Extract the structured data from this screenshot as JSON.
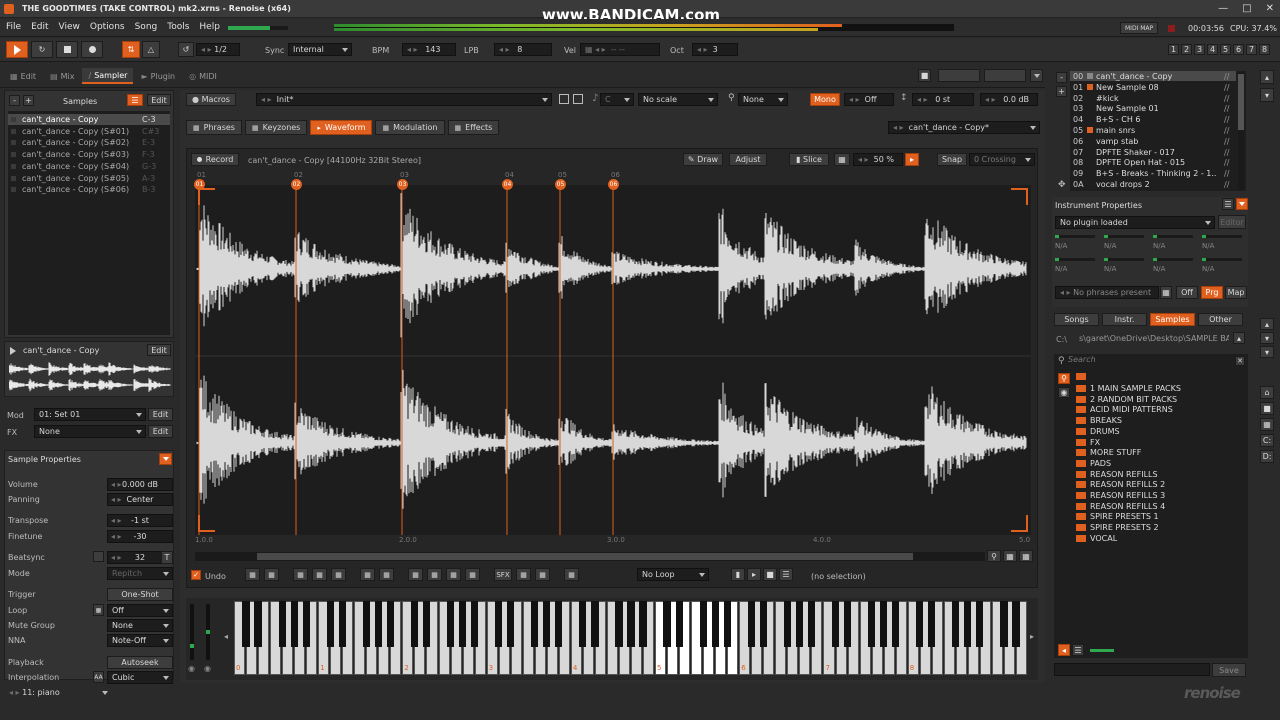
{
  "title_bar": {
    "title": "THE GOODTIMES (TAKE CONTROL) mk2.xrns - Renoise (x64)",
    "watermark": "www.BANDICAM.com"
  },
  "menu": [
    "File",
    "Edit",
    "View",
    "Options",
    "Song",
    "Tools",
    "Help"
  ],
  "status": {
    "midi_map": "MIDI MAP",
    "time": "00:03:56",
    "cpu": "CPU: 37.4%"
  },
  "transport": {
    "loop_value": "1/2",
    "sync_label": "Sync",
    "sync_value": "Internal",
    "bpm_label": "BPM",
    "bpm_value": "143",
    "lpb_label": "LPB",
    "lpb_value": "8",
    "vel_label": "Vel",
    "vel_value": "-- --",
    "oct_label": "Oct",
    "oct_value": "3"
  },
  "page_numbers": [
    "1",
    "2",
    "3",
    "4",
    "5",
    "6",
    "7",
    "8"
  ],
  "tabs": [
    {
      "label": "Edit",
      "active": false
    },
    {
      "label": "Mix",
      "active": false
    },
    {
      "label": "Sampler",
      "active": true
    },
    {
      "label": "Plugin",
      "active": false
    },
    {
      "label": "MIDI",
      "active": false
    }
  ],
  "samples_panel": {
    "title": "Samples",
    "edit": "Edit",
    "items": [
      {
        "name": "can't_dance - Copy",
        "note": "C-3"
      },
      {
        "name": "can't_dance - Copy (S#01)",
        "note": "C#3"
      },
      {
        "name": "can't_dance - Copy (S#02)",
        "note": "E-3"
      },
      {
        "name": "can't_dance - Copy (S#03)",
        "note": "F-3"
      },
      {
        "name": "can't_dance - Copy (S#04)",
        "note": "G-3"
      },
      {
        "name": "can't_dance - Copy (S#05)",
        "note": "A-3"
      },
      {
        "name": "can't_dance - Copy (S#06)",
        "note": "B-3"
      }
    ],
    "selected_name": "can't_dance - Copy",
    "selected_edit": "Edit"
  },
  "mod_fx": {
    "mod_label": "Mod",
    "mod_value": "01: Set 01",
    "fx_label": "FX",
    "fx_value": "None",
    "edit": "Edit"
  },
  "sample_properties": {
    "title": "Sample Properties",
    "rows": [
      {
        "label": "Volume",
        "value": "0.000 dB"
      },
      {
        "label": "Panning",
        "value": "Center"
      },
      {
        "label": "Transpose",
        "value": "-1 st"
      },
      {
        "label": "Finetune",
        "value": "-30"
      },
      {
        "label": "Beatsync",
        "value": "32"
      },
      {
        "label": "Mode",
        "value": "Repitch"
      },
      {
        "label": "Trigger",
        "value": "One-Shot"
      },
      {
        "label": "Loop",
        "value": "Off"
      },
      {
        "label": "Mute Group",
        "value": "None"
      },
      {
        "label": "NNA",
        "value": "Note-Off"
      },
      {
        "label": "Playback",
        "value": "Autoseek"
      },
      {
        "label": "Interpolation",
        "value": "Cubic"
      }
    ]
  },
  "bottom_left": {
    "instrument_select": "11: piano"
  },
  "macros_bar": {
    "macros": "Macros",
    "preset": "Init*",
    "key": "C",
    "scale": "No scale",
    "none": "None",
    "mono": "Mono",
    "off": "Off",
    "transpose": "0 st",
    "volume": "0.0 dB"
  },
  "sub_tabs": [
    {
      "label": "Phrases",
      "active": false
    },
    {
      "label": "Keyzones",
      "active": false
    },
    {
      "label": "Waveform",
      "active": true
    },
    {
      "label": "Modulation",
      "active": false
    },
    {
      "label": "Effects",
      "active": false
    }
  ],
  "sample_selector": "can't_dance - Copy*",
  "waveform_toolbar": {
    "record": "Record",
    "info": "can't_dance - Copy [44100Hz 32Bit Stereo]",
    "draw": "Draw",
    "adjust": "Adjust",
    "slice": "Slice",
    "zoom": "50 %",
    "snap": "Snap",
    "crossing": "0 Crossing"
  },
  "slices": [
    "01",
    "02",
    "03",
    "04",
    "05",
    "06"
  ],
  "ruler": [
    "1.0.0",
    "2.0.0",
    "3.0.0",
    "4.0.0",
    "5.0"
  ],
  "wave_bottom": {
    "undo": "Undo",
    "loop": "No Loop",
    "selection": "(no selection)",
    "sfx": "SFX"
  },
  "octaves": [
    "0",
    "1",
    "2",
    "3",
    "4",
    "5",
    "6",
    "7",
    "8"
  ],
  "instruments": [
    {
      "num": "00",
      "name": "can't_dance - Copy",
      "color": "#888888"
    },
    {
      "num": "01",
      "name": "New Sample 08",
      "color": "#e0601f"
    },
    {
      "num": "02",
      "name": "#kick",
      "color": ""
    },
    {
      "num": "03",
      "name": "New Sample 01",
      "color": ""
    },
    {
      "num": "04",
      "name": "B+S - CH 6",
      "color": ""
    },
    {
      "num": "05",
      "name": "main snrs",
      "color": "#e0601f"
    },
    {
      "num": "06",
      "name": "vamp stab",
      "color": ""
    },
    {
      "num": "07",
      "name": "DPFTE Shaker - 017",
      "color": ""
    },
    {
      "num": "08",
      "name": "DPFTE Open Hat - 015",
      "color": ""
    },
    {
      "num": "09",
      "name": "B+S - Breaks - Thinking 2 - 1...",
      "color": ""
    },
    {
      "num": "0A",
      "name": "vocal drops 2",
      "color": ""
    }
  ],
  "instrument_properties": {
    "title": "Instrument Properties",
    "plugin": "No plugin loaded",
    "editor": "Editor",
    "na": "N/A",
    "phrases": "No phrases present",
    "off": "Off",
    "prg": "Prg",
    "map": "Map"
  },
  "browser": {
    "tabs": [
      {
        "label": "Songs",
        "active": false
      },
      {
        "label": "Instr.",
        "active": false
      },
      {
        "label": "Samples",
        "active": true
      },
      {
        "label": "Other",
        "active": false
      }
    ],
    "path_drive": "C:\\",
    "path": "s\\garet\\OneDrive\\Desktop\\SAMPLE BANK\\",
    "search_placeholder": "Search",
    "folders": [
      "1 MAIN SAMPLE PACKS",
      "2 RANDOM BIT PACKS",
      "ACID MIDI PATTERNS",
      "BREAKS",
      "DRUMS",
      "FX",
      "MORE STUFF",
      "PADS",
      "REASON REFILLS",
      "REASON REFILLS 2",
      "REASON REFILLS 3",
      "REASON REFILLS 4",
      "SPIRE PRESETS 1",
      "SPIRE PRESETS 2",
      "VOCAL"
    ],
    "save": "Save",
    "drive_c": "C:",
    "drive_d": "D:"
  },
  "logo": "renoise",
  "colors": {
    "accent": "#e0601f",
    "bg": "#2a2a2a",
    "wave_bg": "#1d1d1d",
    "waveform": "#d8d8d8"
  }
}
